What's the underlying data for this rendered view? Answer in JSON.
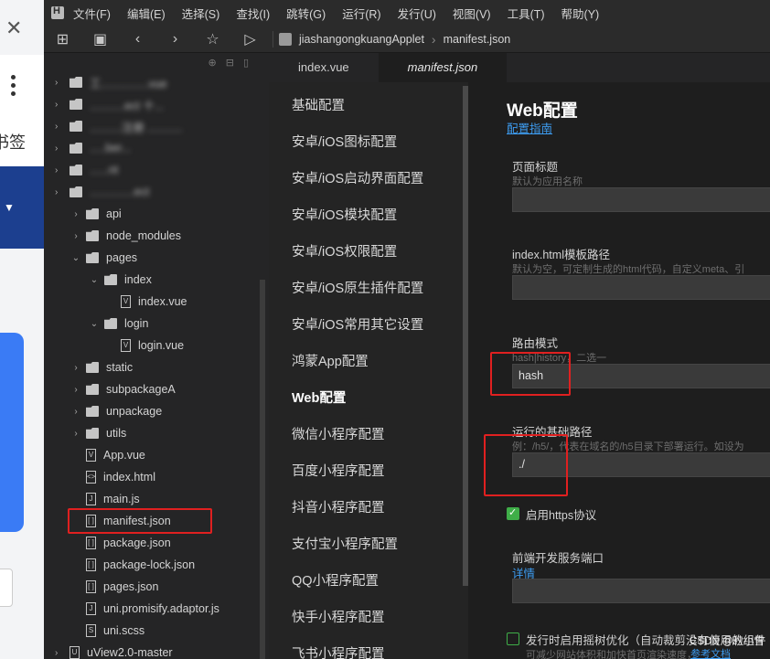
{
  "browser": {
    "close_glyph": "✕",
    "bookmark_text": "书签",
    "dropdown_glyph": "▼"
  },
  "menubar": [
    "文件(F)",
    "编辑(E)",
    "选择(S)",
    "查找(I)",
    "跳转(G)",
    "运行(R)",
    "发行(U)",
    "视图(V)",
    "工具(T)",
    "帮助(Y)"
  ],
  "toolbar": {
    "icons": [
      "new-file-icon",
      "save-icon",
      "back-icon",
      "forward-icon",
      "star-icon",
      "run-icon"
    ],
    "breadcrumb": [
      "jiashangongkuangApplet",
      "manifest.json"
    ]
  },
  "explorer": {
    "blurred_rows": [
      "工...............vue",
      "...........ect 十...",
      "..........注册 ...........",
      ".....ber...",
      "......nt",
      "..............ect"
    ],
    "bottom_root": "uView2.0-master",
    "items": [
      {
        "label": "api",
        "type": "folder",
        "level": 1,
        "chev": "›"
      },
      {
        "label": "node_modules",
        "type": "folder",
        "level": 1,
        "chev": "›"
      },
      {
        "label": "pages",
        "type": "folder",
        "level": 1,
        "chev": "⌄"
      },
      {
        "label": "index",
        "type": "folder",
        "level": 2,
        "chev": "⌄"
      },
      {
        "label": "index.vue",
        "type": "vue",
        "level": 3,
        "chev": ""
      },
      {
        "label": "login",
        "type": "folder",
        "level": 2,
        "chev": "⌄"
      },
      {
        "label": "login.vue",
        "type": "vue",
        "level": 3,
        "chev": ""
      },
      {
        "label": "static",
        "type": "folder",
        "level": 1,
        "chev": "›"
      },
      {
        "label": "subpackageA",
        "type": "folder",
        "level": 1,
        "chev": "›"
      },
      {
        "label": "unpackage",
        "type": "folder",
        "level": 1,
        "chev": "›"
      },
      {
        "label": "utils",
        "type": "folder",
        "level": 1,
        "chev": "›"
      },
      {
        "label": "App.vue",
        "type": "vue",
        "level": 1,
        "chev": ""
      },
      {
        "label": "index.html",
        "type": "html",
        "level": 1,
        "chev": ""
      },
      {
        "label": "main.js",
        "type": "js",
        "level": 1,
        "chev": ""
      },
      {
        "label": "manifest.json",
        "type": "json",
        "level": 1,
        "chev": ""
      },
      {
        "label": "package.json",
        "type": "json",
        "level": 1,
        "chev": ""
      },
      {
        "label": "package-lock.json",
        "type": "json",
        "level": 1,
        "chev": ""
      },
      {
        "label": "pages.json",
        "type": "json",
        "level": 1,
        "chev": ""
      },
      {
        "label": "uni.promisify.adaptor.js",
        "type": "js",
        "level": 1,
        "chev": ""
      },
      {
        "label": "uni.scss",
        "type": "scss",
        "level": 1,
        "chev": ""
      }
    ]
  },
  "tabs": [
    {
      "label": "index.vue",
      "active": false
    },
    {
      "label": "manifest.json",
      "active": true
    }
  ],
  "nav": [
    {
      "label": "基础配置",
      "active": false
    },
    {
      "label": "安卓/iOS图标配置",
      "active": false
    },
    {
      "label": "安卓/iOS启动界面配置",
      "active": false
    },
    {
      "label": "安卓/iOS模块配置",
      "active": false
    },
    {
      "label": "安卓/iOS权限配置",
      "active": false
    },
    {
      "label": "安卓/iOS原生插件配置",
      "active": false
    },
    {
      "label": "安卓/iOS常用其它设置",
      "active": false
    },
    {
      "label": "鸿蒙App配置",
      "active": false
    },
    {
      "label": "Web配置",
      "active": true
    },
    {
      "label": "微信小程序配置",
      "active": false
    },
    {
      "label": "百度小程序配置",
      "active": false
    },
    {
      "label": "抖音小程序配置",
      "active": false
    },
    {
      "label": "支付宝小程序配置",
      "active": false
    },
    {
      "label": "QQ小程序配置",
      "active": false
    },
    {
      "label": "快手小程序配置",
      "active": false
    },
    {
      "label": "飞书小程序配置",
      "active": false
    }
  ],
  "form": {
    "title": "Web配置",
    "guide_link": "配置指南",
    "page_title": {
      "label": "页面标题",
      "hint": "默认为应用名称",
      "value": ""
    },
    "template_path": {
      "label": "index.html模板路径",
      "hint": "默认为空，可定制生成的html代码，自定义meta、引",
      "value": ""
    },
    "router_mode": {
      "label": "路由模式",
      "hint": "hash|history，二选一",
      "value": "hash"
    },
    "base_path": {
      "label": "运行的基础路径",
      "hint": "例：/h5/，代表在域名的/h5目录下部署运行。如设为",
      "value": "./"
    },
    "https": {
      "label": "启用https协议",
      "checked": true
    },
    "dev_port": {
      "label": "前端开发服务端口",
      "link": "详情",
      "value": ""
    },
    "tree_shaking": {
      "label": "发行时启用摇树优化（自动裁剪没有使用的组件",
      "hint": "可减少网站体积和加快首页渲染速度，",
      "link": "参考文档",
      "checked": false
    }
  },
  "watermark": "CSDN @秋小雪",
  "colors": {
    "accent_link": "#3d9cf0",
    "highlight_box": "#e02020",
    "check_green": "#3fae48"
  }
}
